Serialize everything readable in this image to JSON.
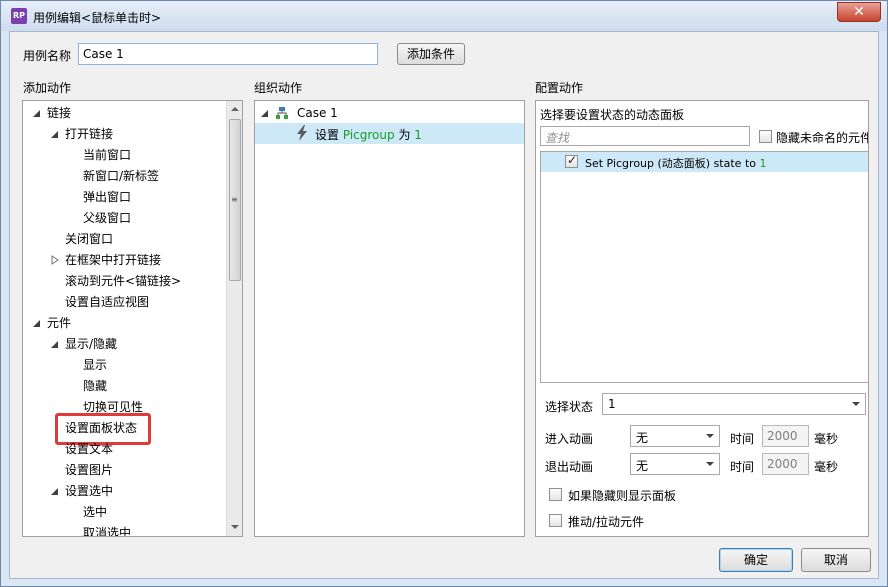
{
  "window": {
    "title": "用例编辑<鼠标单击时>",
    "app_icon_text": "RP",
    "close_glyph": "✕"
  },
  "case_name": {
    "label": "用例名称",
    "value": "Case 1",
    "add_condition_label": "添加条件"
  },
  "add_actions": {
    "header": "添加动作",
    "items": [
      {
        "label": "链接",
        "level": 0,
        "expander": "expanded"
      },
      {
        "label": "打开链接",
        "level": 1,
        "expander": "expanded"
      },
      {
        "label": "当前窗口",
        "level": 2,
        "expander": "none"
      },
      {
        "label": "新窗口/新标签",
        "level": 2,
        "expander": "none"
      },
      {
        "label": "弹出窗口",
        "level": 2,
        "expander": "none"
      },
      {
        "label": "父级窗口",
        "level": 2,
        "expander": "none"
      },
      {
        "label": "关闭窗口",
        "level": 1,
        "expander": "none"
      },
      {
        "label": "在框架中打开链接",
        "level": 1,
        "expander": "collapsed"
      },
      {
        "label": "滚动到元件<锚链接>",
        "level": 1,
        "expander": "none"
      },
      {
        "label": "设置自适应视图",
        "level": 1,
        "expander": "none"
      },
      {
        "label": "元件",
        "level": 0,
        "expander": "expanded"
      },
      {
        "label": "显示/隐藏",
        "level": 1,
        "expander": "expanded"
      },
      {
        "label": "显示",
        "level": 2,
        "expander": "none"
      },
      {
        "label": "隐藏",
        "level": 2,
        "expander": "none"
      },
      {
        "label": "切换可见性",
        "level": 2,
        "expander": "none"
      },
      {
        "label": "设置面板状态",
        "level": 1,
        "expander": "none",
        "highlighted": true
      },
      {
        "label": "设置文本",
        "level": 1,
        "expander": "none"
      },
      {
        "label": "设置图片",
        "level": 1,
        "expander": "none"
      },
      {
        "label": "设置选中",
        "level": 1,
        "expander": "expanded"
      },
      {
        "label": "选中",
        "level": 2,
        "expander": "none"
      },
      {
        "label": "取消选中",
        "level": 2,
        "expander": "none"
      }
    ]
  },
  "organize_actions": {
    "header": "组织动作",
    "case_label": "Case 1",
    "action_prefix": "设置",
    "action_target": "Picgroup",
    "action_mid": "为",
    "action_value": "1"
  },
  "configure_actions": {
    "header": "配置动作",
    "panel_title": "选择要设置状态的动态面板",
    "search_placeholder": "查找",
    "hide_unnamed_label": "隐藏未命名的元件",
    "panel_item_text": "Set Picgroup (动态面板) state to",
    "panel_item_value": "1",
    "select_state_label": "选择状态",
    "select_state_value": "1",
    "enter_anim_label": "进入动画",
    "enter_anim_value": "无",
    "exit_anim_label": "退出动画",
    "exit_anim_value": "无",
    "time_label": "时间",
    "enter_time": "2000",
    "exit_time": "2000",
    "ms_label": "毫秒",
    "show_if_hidden_label": "如果隐藏则显示面板",
    "push_pull_label": "推动/拉动元件"
  },
  "footer": {
    "ok_label": "确定",
    "cancel_label": "取消"
  },
  "colors": {
    "highlight_border": "#e03a3a",
    "selection_bg": "#cde8f6",
    "value_green": "#1a9e2a"
  }
}
